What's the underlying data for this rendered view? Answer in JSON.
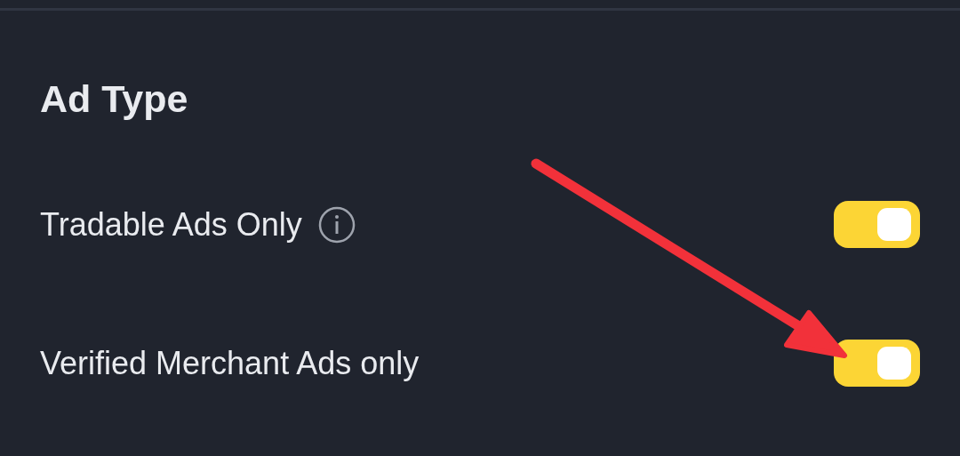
{
  "section": {
    "title": "Ad Type"
  },
  "toggles": [
    {
      "label": "Tradable Ads Only",
      "info": true,
      "on": true
    },
    {
      "label": "Verified Merchant Ads only",
      "info": false,
      "on": true
    }
  ]
}
